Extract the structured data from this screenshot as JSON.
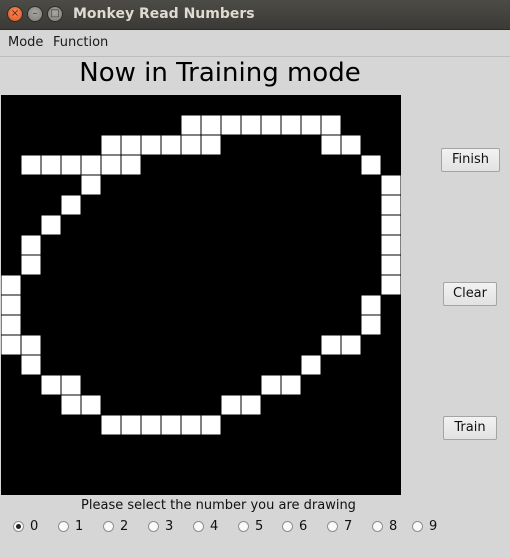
{
  "window": {
    "title": "Monkey Read Numbers",
    "close_glyph": "×",
    "minimize_glyph": "–",
    "maximize_glyph": "□"
  },
  "menu": {
    "items": [
      "Mode",
      "Function"
    ]
  },
  "heading": "Now in Training mode",
  "drawing_grid": {
    "columns": 20,
    "rows": 20,
    "background_color": "#000000",
    "pixel_color": "#ffffff",
    "filled_cells": [
      [
        9,
        1
      ],
      [
        10,
        1
      ],
      [
        11,
        1
      ],
      [
        12,
        1
      ],
      [
        13,
        1
      ],
      [
        14,
        1
      ],
      [
        15,
        1
      ],
      [
        16,
        1
      ],
      [
        5,
        2
      ],
      [
        6,
        2
      ],
      [
        7,
        2
      ],
      [
        8,
        2
      ],
      [
        9,
        2
      ],
      [
        10,
        2
      ],
      [
        16,
        2
      ],
      [
        17,
        2
      ],
      [
        1,
        3
      ],
      [
        2,
        3
      ],
      [
        3,
        3
      ],
      [
        4,
        3
      ],
      [
        5,
        3
      ],
      [
        6,
        3
      ],
      [
        18,
        3
      ],
      [
        4,
        4
      ],
      [
        19,
        4
      ],
      [
        3,
        5
      ],
      [
        19,
        5
      ],
      [
        2,
        6
      ],
      [
        19,
        6
      ],
      [
        1,
        7
      ],
      [
        19,
        7
      ],
      [
        1,
        8
      ],
      [
        19,
        8
      ],
      [
        0,
        9
      ],
      [
        19,
        9
      ],
      [
        0,
        10
      ],
      [
        18,
        10
      ],
      [
        0,
        11
      ],
      [
        18,
        11
      ],
      [
        0,
        12
      ],
      [
        1,
        12
      ],
      [
        16,
        12
      ],
      [
        17,
        12
      ],
      [
        1,
        13
      ],
      [
        15,
        13
      ],
      [
        2,
        14
      ],
      [
        3,
        14
      ],
      [
        13,
        14
      ],
      [
        14,
        14
      ],
      [
        3,
        15
      ],
      [
        4,
        15
      ],
      [
        11,
        15
      ],
      [
        12,
        15
      ],
      [
        5,
        16
      ],
      [
        6,
        16
      ],
      [
        7,
        16
      ],
      [
        8,
        16
      ],
      [
        9,
        16
      ],
      [
        10,
        16
      ]
    ]
  },
  "buttons": {
    "finish": "Finish",
    "clear": "Clear",
    "train": "Train"
  },
  "prompt": "Please select the number you are drawing",
  "digits": {
    "options": [
      "0",
      "1",
      "2",
      "3",
      "4",
      "5",
      "6",
      "7",
      "8",
      "9"
    ],
    "selected": "0"
  }
}
